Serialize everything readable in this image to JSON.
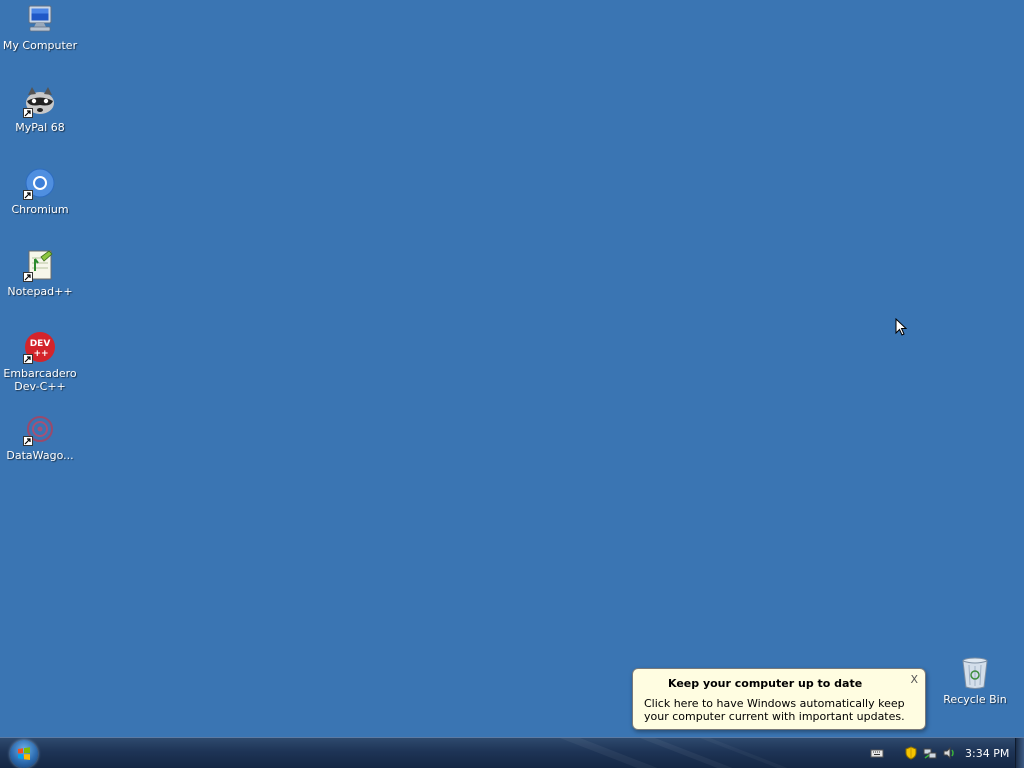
{
  "desktop": {
    "background_color": "#3a75b3",
    "icons": [
      {
        "label": "My Computer",
        "icon": "computer-icon",
        "shortcut": false
      },
      {
        "label": "MyPal 68",
        "icon": "raccoon-icon",
        "shortcut": true
      },
      {
        "label": "Chromium",
        "icon": "chromium-icon",
        "shortcut": true
      },
      {
        "label": "Notepad++",
        "icon": "notepad-plus-plus-icon",
        "shortcut": true
      },
      {
        "label": "Embarcadero\nDev-C++",
        "icon": "dev-cpp-icon",
        "shortcut": true,
        "badge_top": "DEV",
        "badge_bottom": "++"
      },
      {
        "label": "DataWago...",
        "icon": "datawagon-icon",
        "shortcut": true
      },
      {
        "label": "Recycle Bin",
        "icon": "recycle-bin-icon",
        "shortcut": false
      }
    ]
  },
  "balloon": {
    "title": "Keep your computer up to date",
    "body": "Click here to have Windows automatically keep your computer current with important updates.",
    "close_label": "X"
  },
  "taskbar": {
    "start_icon": "windows-logo-icon",
    "tray_icons": [
      "keyboard-icon",
      "security-shield-icon",
      "network-icon",
      "volume-icon"
    ],
    "clock": "3:34 PM"
  }
}
